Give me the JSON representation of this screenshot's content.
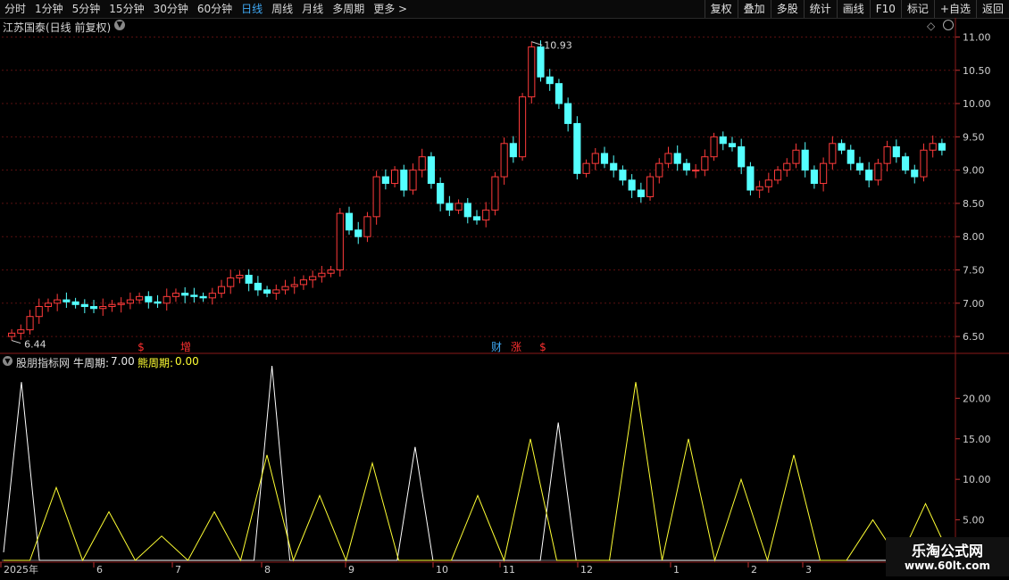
{
  "toolbar": {
    "periods": [
      "分时",
      "1分钟",
      "5分钟",
      "15分钟",
      "30分钟",
      "60分钟",
      "日线",
      "周线",
      "月线",
      "多周期",
      "更多 >"
    ],
    "active_period": "日线",
    "actions": [
      "复权",
      "叠加",
      "多股",
      "统计",
      "画线",
      "F10",
      "标记",
      "+自选",
      "返回"
    ]
  },
  "main_chart": {
    "title": "江苏国泰(日线 前复权)",
    "high_label": "10.93",
    "low_label": "6.44",
    "markers": [
      {
        "text": "$",
        "color": "#ff3030"
      },
      {
        "text": "增",
        "color": "#ff3030"
      },
      {
        "text": "财",
        "color": "#3fa9f5"
      },
      {
        "text": "涨",
        "color": "#ff3030"
      },
      {
        "text": "$",
        "color": "#ff3030"
      }
    ]
  },
  "indicator": {
    "name": "股朋指标网",
    "bull_label": "牛周期:",
    "bull_value": "7.00",
    "bear_label": "熊周期:",
    "bear_value": "0.00"
  },
  "x_axis": {
    "labels": [
      "2025年",
      "6",
      "7",
      "8",
      "9",
      "10",
      "11",
      "12",
      "1",
      "2",
      "3"
    ]
  },
  "watermark": {
    "title": "乐淘公式网",
    "url": "www.60lt.com"
  },
  "colors": {
    "up": "#ff3b3b",
    "down": "#54ffff",
    "bull": "#ffffff",
    "bear": "#ffff33",
    "grid": "#5a1010",
    "accent": "#3fa9f5"
  },
  "chart_data": [
    {
      "type": "candlestick",
      "title": "江苏国泰(日线 前复权)",
      "y_ticks": [
        "11.00",
        "10.50",
        "10.00",
        "9.50",
        "9.00",
        "8.50",
        "8.00",
        "7.50",
        "7.00",
        "6.50"
      ],
      "ylim": [
        6.3,
        11.1
      ],
      "close_series": [
        6.55,
        6.6,
        6.8,
        6.95,
        7.0,
        7.05,
        7.02,
        6.98,
        6.95,
        6.92,
        6.95,
        6.98,
        7.0,
        7.05,
        7.1,
        7.02,
        7.0,
        7.1,
        7.15,
        7.12,
        7.1,
        7.08,
        7.15,
        7.25,
        7.38,
        7.42,
        7.3,
        7.2,
        7.15,
        7.2,
        7.25,
        7.28,
        7.35,
        7.4,
        7.45,
        7.5,
        8.35,
        8.1,
        8.0,
        8.3,
        8.9,
        8.8,
        9.0,
        8.7,
        9.0,
        9.2,
        8.8,
        8.5,
        8.4,
        8.5,
        8.3,
        8.25,
        8.4,
        8.9,
        9.4,
        9.2,
        10.1,
        10.85,
        10.4,
        10.3,
        10.0,
        9.7,
        8.95,
        9.1,
        9.25,
        9.1,
        9.0,
        8.85,
        8.7,
        8.6,
        8.9,
        9.1,
        9.25,
        9.1,
        9.0,
        9.0,
        9.2,
        9.5,
        9.4,
        9.35,
        9.05,
        8.7,
        8.75,
        8.85,
        9.0,
        9.1,
        9.3,
        9.0,
        8.8,
        9.1,
        9.4,
        9.3,
        9.1,
        9.0,
        8.85,
        9.1,
        9.35,
        9.2,
        9.0,
        8.9,
        9.3,
        9.4,
        9.3
      ],
      "annotations": [
        "10.93",
        "6.44"
      ]
    },
    {
      "type": "line",
      "title": "股朋指标网",
      "y_ticks": [
        "20.00",
        "15.00",
        "10.00",
        "5.00"
      ],
      "ylim": [
        0,
        24
      ],
      "series": [
        {
          "name": "牛周期",
          "color": "#ffffff",
          "values": [
            1,
            22,
            0,
            0,
            0,
            0,
            0,
            0,
            0,
            0,
            0,
            0,
            0,
            0,
            0,
            24,
            0,
            0,
            0,
            0,
            0,
            0,
            0,
            14,
            0,
            0,
            0,
            0,
            0,
            0,
            0,
            17,
            0,
            0,
            0,
            0,
            0,
            0,
            0,
            0,
            0,
            0,
            0,
            0,
            0,
            0,
            0,
            0,
            0,
            0,
            0,
            0,
            0,
            0
          ]
        },
        {
          "name": "熊周期",
          "color": "#ffff33",
          "values": [
            0,
            0,
            9,
            0,
            6,
            0,
            3,
            0,
            6,
            0,
            13,
            0,
            8,
            0,
            12,
            0,
            0,
            0,
            8,
            0,
            15,
            0,
            0,
            0,
            22,
            0,
            15,
            0,
            10,
            0,
            13,
            0,
            0,
            5,
            0,
            7,
            0
          ]
        }
      ]
    }
  ]
}
